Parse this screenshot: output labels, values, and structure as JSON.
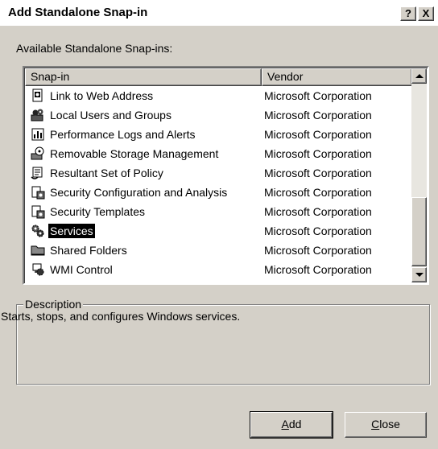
{
  "window": {
    "title": "Add Standalone Snap-in",
    "help_button": "?",
    "close_button": "X"
  },
  "available_label": "Available Standalone Snap-ins:",
  "list": {
    "columns": [
      "Snap-in",
      "Vendor"
    ],
    "rows": [
      {
        "name": "Link to Web Address",
        "vendor": "Microsoft Corporation",
        "icon": "link-icon",
        "selected": false
      },
      {
        "name": "Local Users and Groups",
        "vendor": "Microsoft Corporation",
        "icon": "users-icon",
        "selected": false
      },
      {
        "name": "Performance Logs and Alerts",
        "vendor": "Microsoft Corporation",
        "icon": "performance-icon",
        "selected": false
      },
      {
        "name": "Removable Storage Management",
        "vendor": "Microsoft Corporation",
        "icon": "removable-storage-icon",
        "selected": false
      },
      {
        "name": "Resultant Set of Policy",
        "vendor": "Microsoft Corporation",
        "icon": "policy-icon",
        "selected": false
      },
      {
        "name": "Security Configuration and Analysis",
        "vendor": "Microsoft Corporation",
        "icon": "security-config-icon",
        "selected": false
      },
      {
        "name": "Security Templates",
        "vendor": "Microsoft Corporation",
        "icon": "security-templates-icon",
        "selected": false
      },
      {
        "name": "Services",
        "vendor": "Microsoft Corporation",
        "icon": "services-gear-icon",
        "selected": true
      },
      {
        "name": "Shared Folders",
        "vendor": "Microsoft Corporation",
        "icon": "shared-folder-icon",
        "selected": false
      },
      {
        "name": "WMI Control",
        "vendor": "Microsoft Corporation",
        "icon": "wmi-icon",
        "selected": false
      }
    ]
  },
  "description": {
    "legend": "Description",
    "text": "Starts, stops, and configures Windows services."
  },
  "buttons": {
    "add": "Add",
    "close": "Close"
  },
  "colors": {
    "dialog_bg": "#d4d0c8",
    "selection_bg": "#000000"
  }
}
